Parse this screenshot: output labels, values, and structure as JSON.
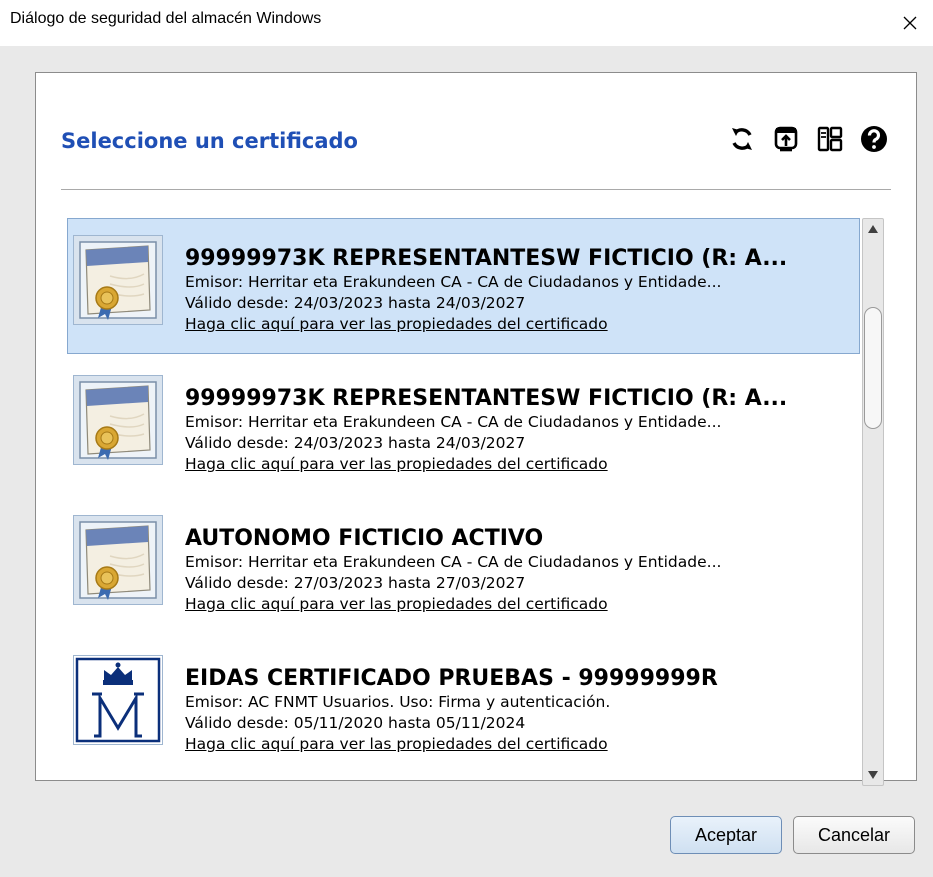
{
  "window": {
    "title": "Diálogo de seguridad del almacén Windows",
    "close_icon": "close-icon"
  },
  "dialog": {
    "heading": "Seleccione un certificado",
    "toolbar": [
      {
        "icon": "refresh-icon"
      },
      {
        "icon": "import-icon"
      },
      {
        "icon": "view-details-icon"
      },
      {
        "icon": "help-icon"
      }
    ]
  },
  "certificates": [
    {
      "name": "99999973K REPRESENTANTESW FICTICIO (R: A...",
      "issuer": "Emisor: Herritar eta Erakundeen CA - CA de Ciudadanos y Entidade...",
      "validity": "Válido desde: 24/03/2023 hasta 24/03/2027",
      "link": "Haga clic aquí para ver las propiedades del certificado",
      "icon": "certificate-seal-icon",
      "selected": true
    },
    {
      "name": "99999973K REPRESENTANTESW FICTICIO (R: A...",
      "issuer": "Emisor: Herritar eta Erakundeen CA - CA de Ciudadanos y Entidade...",
      "validity": "Válido desde: 24/03/2023 hasta 24/03/2027",
      "link": "Haga clic aquí para ver las propiedades del certificado",
      "icon": "certificate-seal-icon",
      "selected": false
    },
    {
      "name": "AUTONOMO FICTICIO ACTIVO",
      "issuer": "Emisor: Herritar eta Erakundeen CA - CA de Ciudadanos y Entidade...",
      "validity": "Válido desde: 27/03/2023 hasta 27/03/2027",
      "link": "Haga clic aquí para ver las propiedades del certificado",
      "icon": "certificate-seal-icon",
      "selected": false
    },
    {
      "name": "EIDAS CERTIFICADO PRUEBAS - 99999999R",
      "issuer": "Emisor: AC FNMT Usuarios. Uso: Firma y autenticación.",
      "validity": "Válido desde: 05/11/2020 hasta 05/11/2024",
      "link": "Haga clic aquí para ver las propiedades del certificado",
      "icon": "fnmt-crown-m-icon",
      "selected": false
    }
  ],
  "buttons": {
    "ok": "Aceptar",
    "cancel": "Cancelar"
  },
  "colors": {
    "heading": "#1f4fb5",
    "selection": "#cfe3f8"
  }
}
